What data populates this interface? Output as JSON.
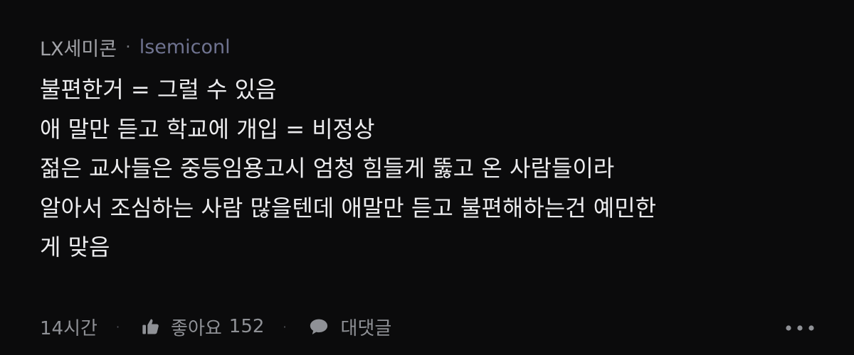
{
  "comment": {
    "author": "LX세미콘",
    "separator": "·",
    "handle": "lsemiconl",
    "lines": [
      "불편한거 = 그럴 수 있음",
      "애 말만 듣고 학교에 개입 = 비정상",
      "젊은 교사들은 중등임용고시 엄청 힘들게 뚫고 온 사람들이라",
      "알아서 조심하는 사람 많을텐데 애말만 듣고 불편해하는건 예민한",
      "게 맞음"
    ],
    "footer": {
      "time": "14시간",
      "like_label": "좋아요",
      "like_count": "152",
      "reply_label": "대댓글",
      "separator": "·"
    }
  },
  "icons": {
    "like": "thumbs-up-icon",
    "reply": "speech-bubble-icon",
    "more": "more-dots-icon"
  },
  "colors": {
    "background": "#0b0b0c",
    "text": "#ececee",
    "muted": "#8f9196",
    "handle": "#6f7390"
  }
}
